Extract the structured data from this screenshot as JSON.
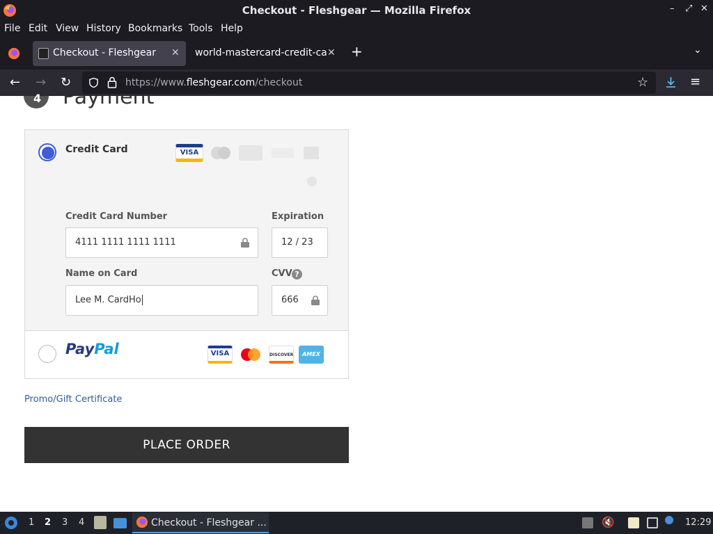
{
  "window": {
    "title": "Checkout - Fleshgear — Mozilla Firefox"
  },
  "menu": {
    "items": [
      "File",
      "Edit",
      "View",
      "History",
      "Bookmarks",
      "Tools",
      "Help"
    ]
  },
  "tabs": [
    {
      "label": "Checkout - Fleshgear",
      "active": true
    },
    {
      "label": "world-mastercard-credit-card",
      "active": false
    }
  ],
  "urlbar": {
    "prefix": "https://www.",
    "domain": "fleshgear.com",
    "path": "/checkout"
  },
  "checkout": {
    "step_number": "4",
    "step_title": "Payment",
    "credit_card": {
      "label": "Credit Card",
      "selected": true,
      "card_logos": [
        "VISA"
      ],
      "fields": {
        "number_label": "Credit Card Number",
        "number_value": "4111 1111 1111 1111",
        "expiration_label": "Expiration",
        "expiration_value": "12 / 23",
        "name_label": "Name on Card",
        "name_value": "Lee M. CardHo",
        "cvv_label": "CVV",
        "cvv_help": "?",
        "cvv_value": "666"
      }
    },
    "paypal": {
      "label_pay": "Pay",
      "label_pal": "Pal",
      "selected": false,
      "card_logos": [
        "VISA",
        "DISCOVER",
        "AMEX"
      ]
    },
    "promo_link": "Promo/Gift Certificate",
    "place_order": "PLACE ORDER"
  },
  "taskbar": {
    "workspaces": [
      "1",
      "2",
      "3",
      "4"
    ],
    "active_task": "Checkout - Fleshgear ...",
    "clock": "12:29"
  },
  "colors": {
    "accent_radio": "#3f5cdb",
    "button_dark": "#333333",
    "link": "#2f5e9c"
  }
}
